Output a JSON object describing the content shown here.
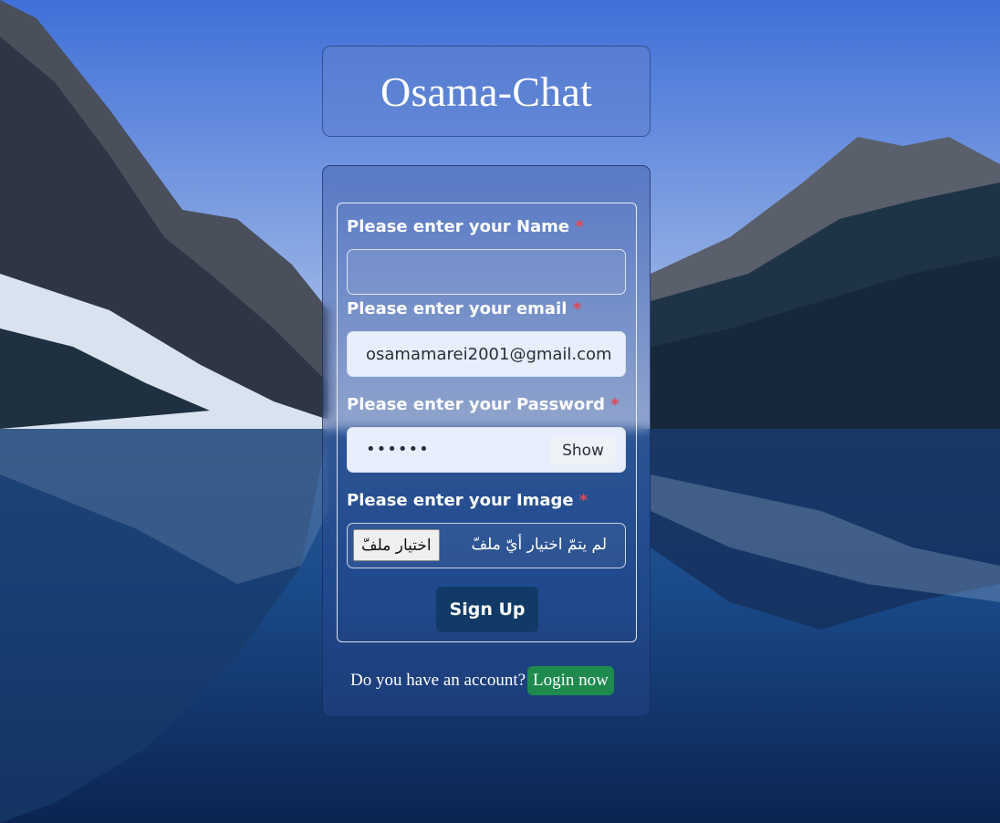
{
  "app": {
    "title": "Osama-Chat"
  },
  "form": {
    "name": {
      "label": "Please enter your Name",
      "required_mark": "*",
      "value": ""
    },
    "email": {
      "label": "Please enter your email",
      "required_mark": "*",
      "value": "osamamarei2001@gmail.com"
    },
    "password": {
      "label": "Please enter your Password",
      "required_mark": "*",
      "masked_value": "••••••",
      "toggle_label": "Show"
    },
    "image": {
      "label": "Please enter your Image",
      "required_mark": "*",
      "button_label": "اختيار ملفّ",
      "status_text": "لم يتمّ اختيار أيّ ملفّ"
    },
    "submit_label": "Sign Up"
  },
  "footer": {
    "prompt": "Do you have an account?",
    "login_label": "Login now"
  },
  "colors": {
    "required": "#e3484f",
    "submit": "#123a66",
    "login": "#1e8a4e"
  }
}
